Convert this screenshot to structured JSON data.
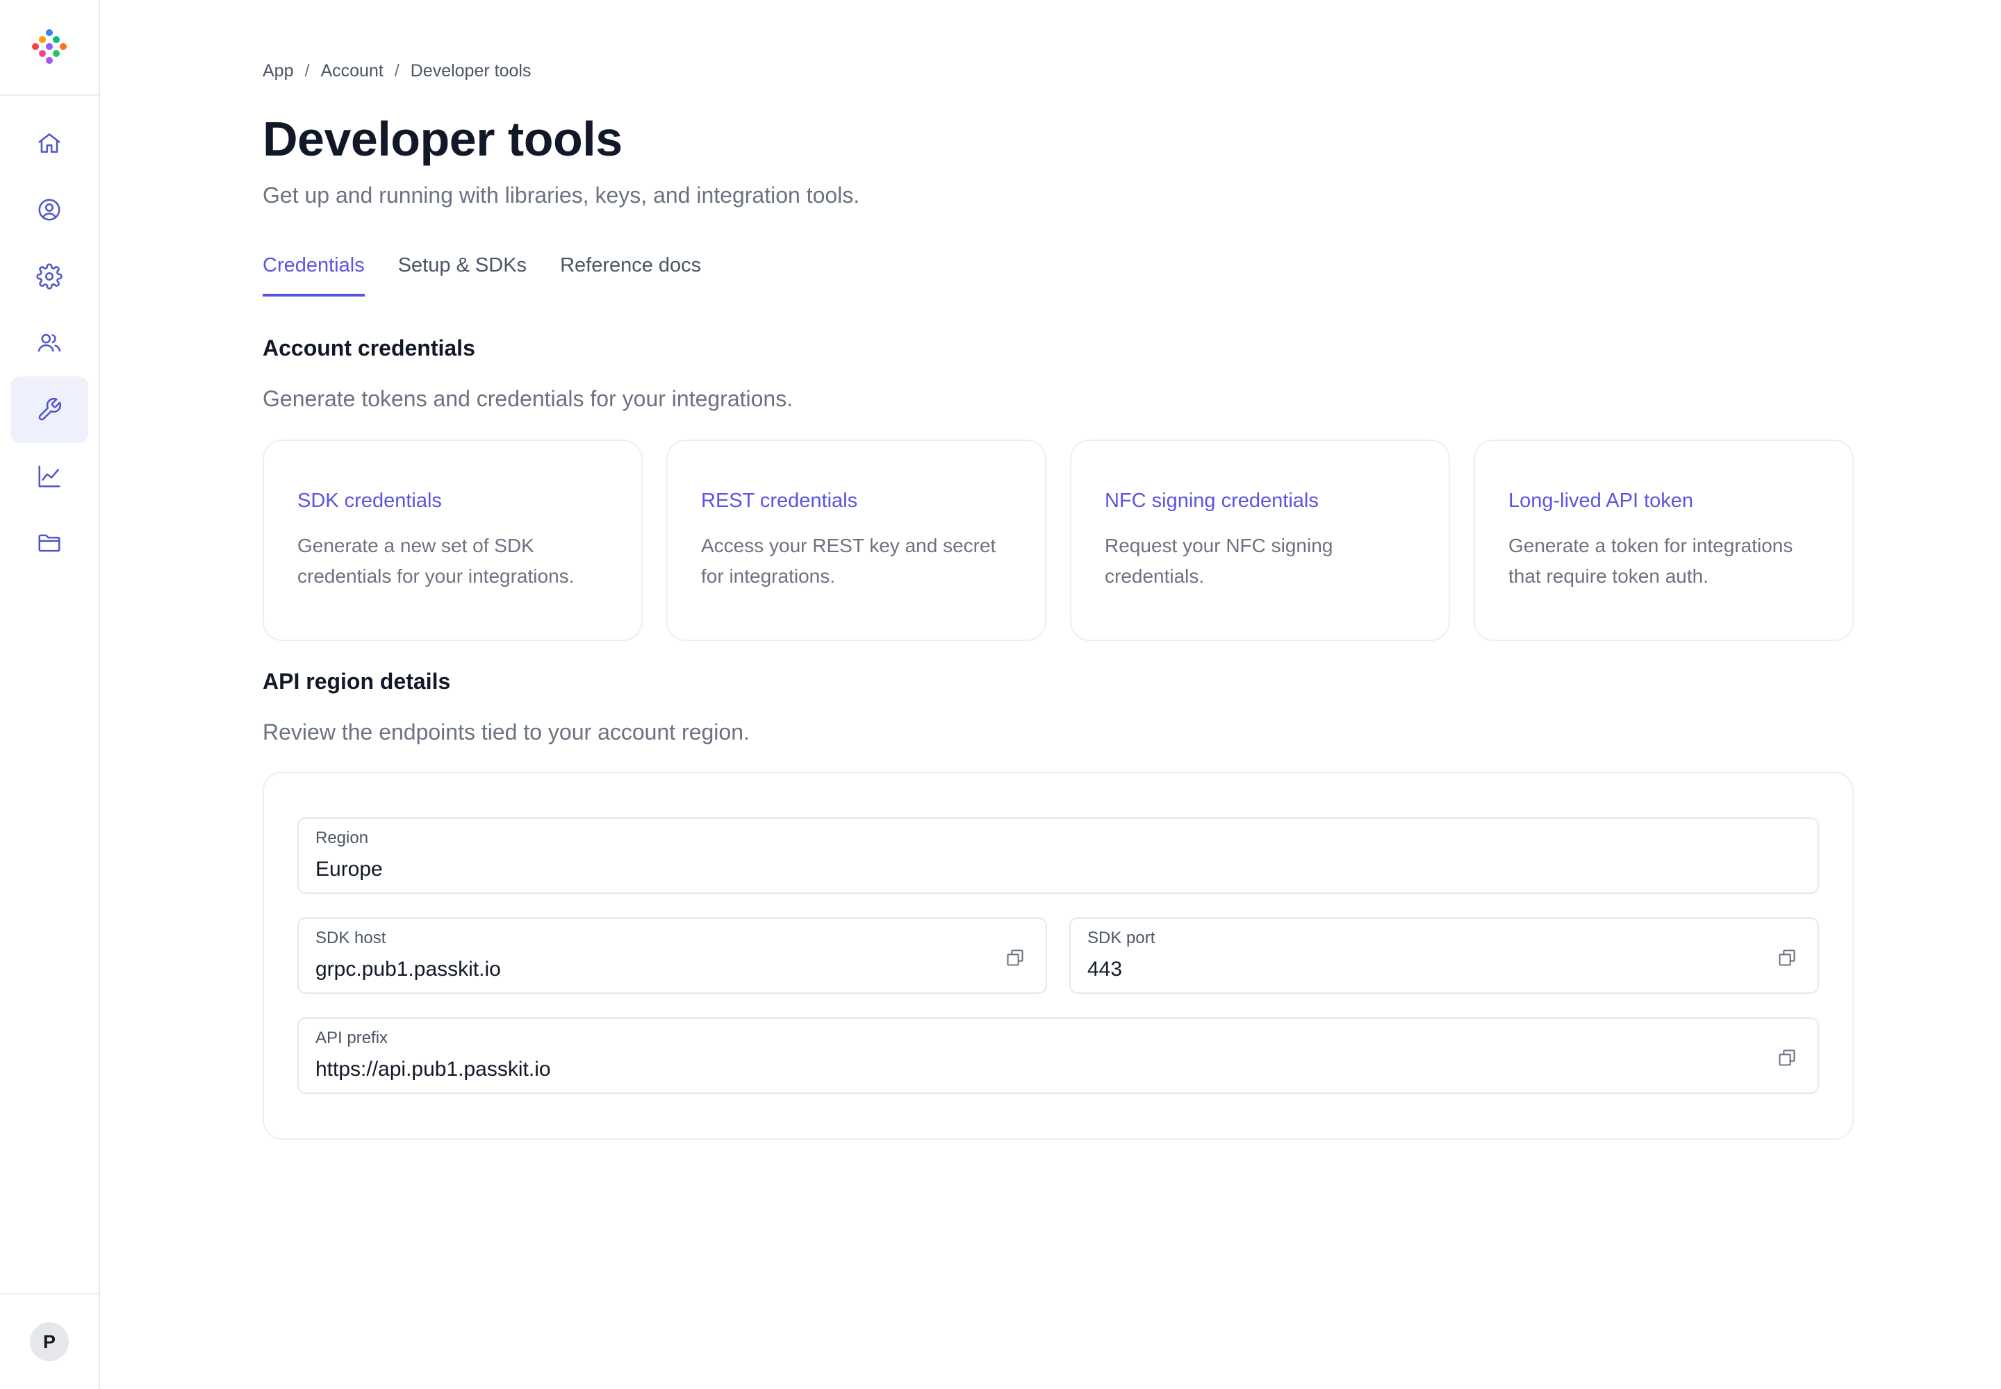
{
  "app": {
    "logo_name": "app-logo",
    "avatar_initial": "P"
  },
  "sidebar": {
    "items": [
      {
        "icon": "home-icon",
        "active": false
      },
      {
        "icon": "user-circle-icon",
        "active": false
      },
      {
        "icon": "gear-icon",
        "active": false
      },
      {
        "icon": "users-icon",
        "active": false
      },
      {
        "icon": "wrench-icon",
        "active": true
      },
      {
        "icon": "chart-line-icon",
        "active": false
      },
      {
        "icon": "folder-icon",
        "active": false
      }
    ]
  },
  "breadcrumb": {
    "items": [
      "App",
      "Account",
      "Developer tools"
    ],
    "separator": "/"
  },
  "page": {
    "title": "Developer tools",
    "subtitle": "Get up and running with libraries, keys, and integration tools."
  },
  "tabs": [
    {
      "label": "Credentials",
      "active": true
    },
    {
      "label": "Setup & SDKs",
      "active": false
    },
    {
      "label": "Reference docs",
      "active": false
    }
  ],
  "account_credentials": {
    "title": "Account credentials",
    "description": "Generate tokens and credentials for your integrations.",
    "cards": [
      {
        "title": "SDK credentials",
        "description": "Generate a new set of SDK credentials for your integrations."
      },
      {
        "title": "REST credentials",
        "description": "Access your REST key and secret for integrations."
      },
      {
        "title": "NFC signing credentials",
        "description": "Request your NFC signing credentials."
      },
      {
        "title": "Long-lived API token",
        "description": "Generate a token for integrations that require token auth."
      }
    ]
  },
  "api_region": {
    "title": "API region details",
    "description": "Review the endpoints tied to your account region.",
    "region": {
      "label": "Region",
      "value": "Europe"
    },
    "sdk_host": {
      "label": "SDK host",
      "value": "grpc.pub1.passkit.io"
    },
    "sdk_port": {
      "label": "SDK port",
      "value": "443"
    },
    "api_prefix": {
      "label": "API prefix",
      "value": "https://api.pub1.passkit.io"
    }
  },
  "colors": {
    "accent": "#5b54e0",
    "icon": "#4f56c9",
    "active_nav_bg": "#eef0fb",
    "muted_text": "#6b7280",
    "border": "#e5e7eb"
  }
}
